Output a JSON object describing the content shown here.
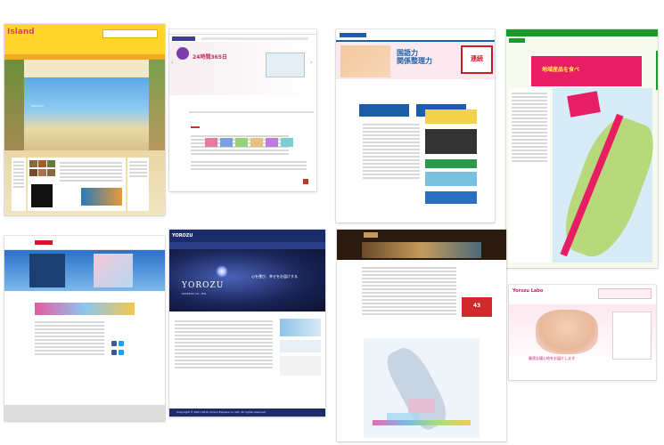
{
  "screens": {
    "resort": {
      "logo": "Island",
      "welcome": "Welcome",
      "accent": "#ffd52e"
    },
    "tech": {
      "headline": "24時間365日",
      "accent": "#cc2b5e"
    },
    "education": {
      "headline_1": "国語力",
      "headline_2": "関係整理力",
      "badge": "連続",
      "accent": "#1c5fa8"
    },
    "rail": {
      "banner": "地域産品を食べ",
      "accent": "#e81e64"
    },
    "travel": {
      "accent": "#2a71c8"
    },
    "logistics": {
      "logo": "YOROZU",
      "hero_title": "YOROZU",
      "hero_sub": "EXPRESS CO., LTD.",
      "slogan": "心を運び、幸せをお届けする",
      "copyright": "Copyright © 2007-2010 Yorozu Express co.,Ltd. All rights reserved.",
      "accent": "#1c2c6a"
    },
    "japan_tour": {
      "card": "43",
      "accent": "#d22a2a"
    },
    "bedding": {
      "logo": "Yorozu Labo",
      "caption": "最適な寝心地をお届けします",
      "accent": "#c81e6a"
    }
  }
}
